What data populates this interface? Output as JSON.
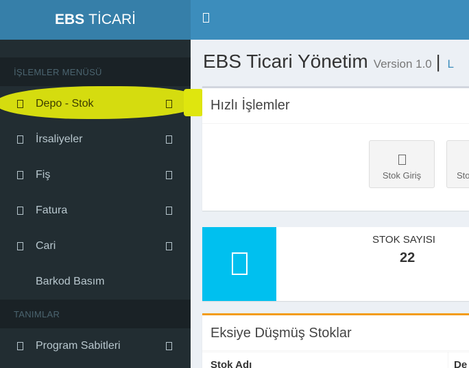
{
  "logo": {
    "bold": "EBS",
    "rest": "TİCARİ"
  },
  "sidebar": {
    "section1": "İŞLEMLER MENÜSÜ",
    "items1": [
      {
        "label": "Depo - Stok",
        "has_chevron": true
      },
      {
        "label": "İrsaliyeler",
        "has_chevron": true
      },
      {
        "label": "Fiş",
        "has_chevron": true
      },
      {
        "label": "Fatura",
        "has_chevron": true
      },
      {
        "label": "Cari",
        "has_chevron": true
      },
      {
        "label": "Barkod Basım",
        "has_chevron": false
      }
    ],
    "section2": "TANIMLAR",
    "items2": [
      {
        "label": "Program Sabitleri",
        "has_chevron": true
      }
    ]
  },
  "content": {
    "title": "EBS Ticari Yönetim",
    "version": "Version 1.0",
    "separator": "|",
    "tail": "L"
  },
  "quick": {
    "title": "Hızlı İşlemler",
    "btn1": "Stok Giriş",
    "btn2": "Sto"
  },
  "stats": {
    "label": "STOK SAYISI",
    "value": "22"
  },
  "negative": {
    "title": "Eksiye Düşmüş Stoklar",
    "col1": "Stok Adı",
    "col2": "De"
  },
  "colors": {
    "header": "#3c8dbc",
    "logo": "#367fa9",
    "sidebar": "#222d32",
    "info": "#00c0ef",
    "warning": "#f39c12",
    "highlight": "#dfe60e"
  }
}
